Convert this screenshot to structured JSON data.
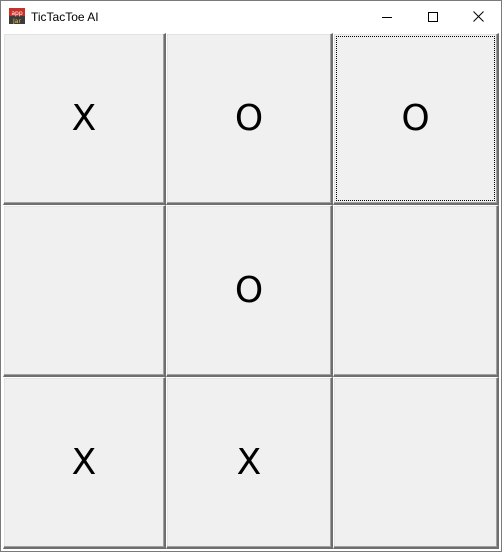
{
  "window": {
    "title": "TicTacToe AI",
    "icon": "java-app-icon",
    "controls": {
      "minimize": "minimize-icon",
      "maximize": "maximize-icon",
      "close": "close-icon"
    }
  },
  "board": {
    "cells": [
      "X",
      "O",
      "O",
      "",
      "O",
      "",
      "X",
      "X",
      ""
    ],
    "focused_cell": 2
  },
  "colors": {
    "cell_background": "#f0f0f0",
    "mark": "#000000",
    "titlebar": "#ffffff"
  }
}
